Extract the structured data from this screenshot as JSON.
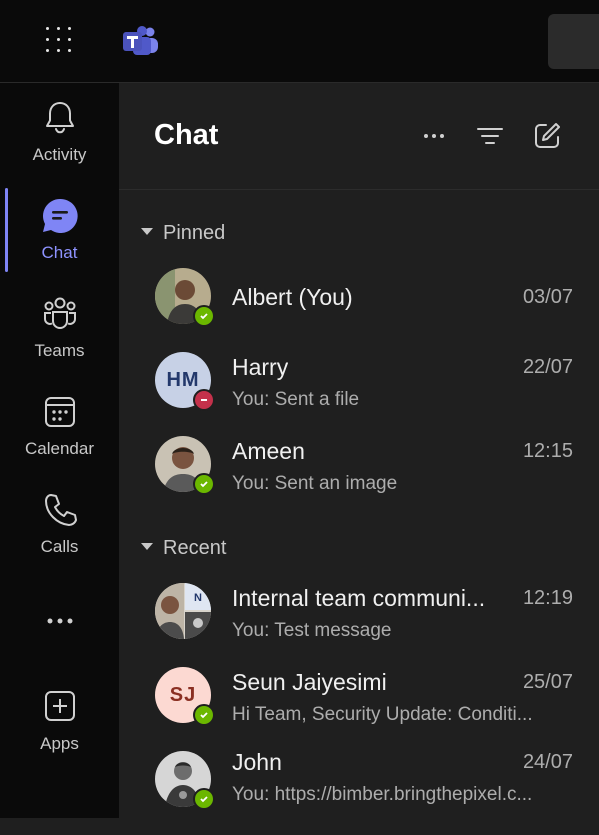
{
  "nav": {
    "items": [
      {
        "label": "Activity"
      },
      {
        "label": "Chat"
      },
      {
        "label": "Teams"
      },
      {
        "label": "Calendar"
      },
      {
        "label": "Calls"
      },
      {
        "label": "Apps"
      }
    ],
    "active": "Chat"
  },
  "panel": {
    "title": "Chat"
  },
  "sections": {
    "pinned": {
      "label": "Pinned"
    },
    "recent": {
      "label": "Recent"
    }
  },
  "chats": {
    "pinned": [
      {
        "name": "Albert (You)",
        "preview": "",
        "time": "03/07",
        "status": "available"
      },
      {
        "name": "Harry",
        "preview": "You: Sent a file",
        "time": "22/07",
        "status": "busy",
        "initials": "HM"
      },
      {
        "name": "Ameen",
        "preview": "You: Sent an image",
        "time": "12:15",
        "status": "available"
      }
    ],
    "recent": [
      {
        "name": "Internal team communi...",
        "preview": "You: Test message",
        "time": "12:19",
        "group_badge": "N"
      },
      {
        "name": "Seun Jaiyesimi",
        "preview": "Hi Team,   Security Update: Conditi...",
        "time": "25/07",
        "status": "available",
        "initials": "SJ"
      },
      {
        "name": "John",
        "preview": "You: https://bimber.bringthepixel.c...",
        "time": "24/07",
        "status": "available"
      }
    ]
  },
  "colors": {
    "accent": "#7f85f5",
    "available": "#6bb700",
    "busy": "#c4314b",
    "panel_bg": "#1f1f1f",
    "rail_bg": "#0a0a0a"
  }
}
